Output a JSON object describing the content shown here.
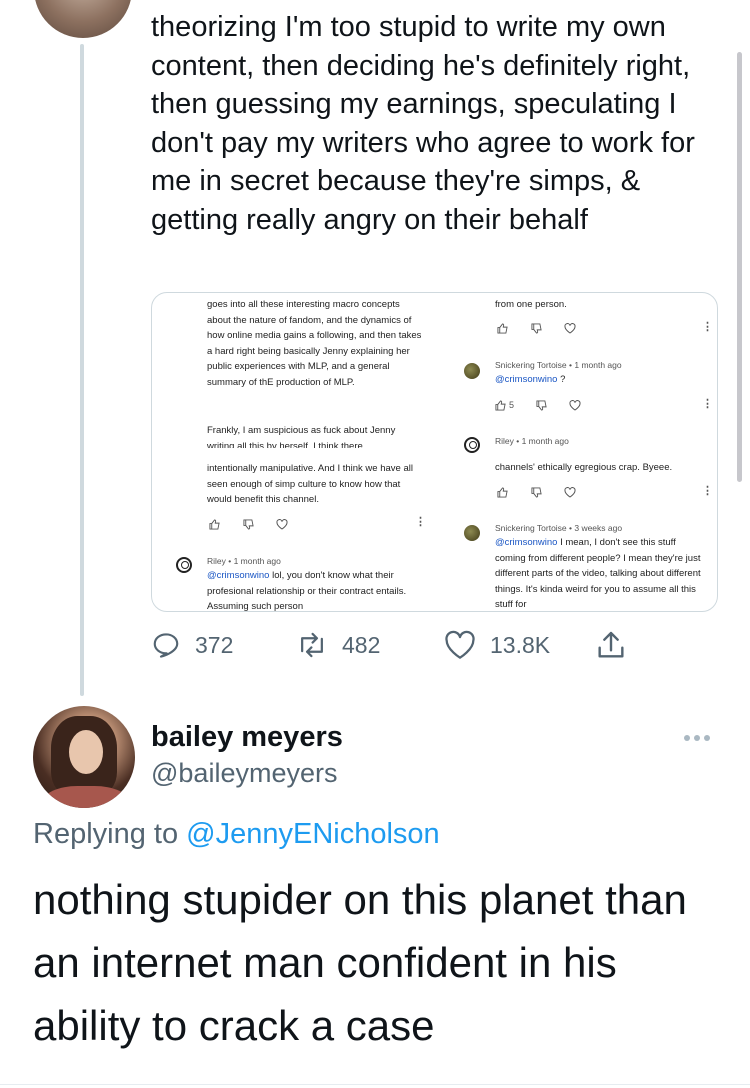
{
  "tweet1": {
    "text": "theorizing I'm too stupid to write my own content, then deciding he's definitely right, then guessing my earnings, speculating I don't pay my writers who agree to work for me in secret because they're simps, & getting really angry on their behalf",
    "replies": "372",
    "retweets": "482",
    "likes": "13.8K"
  },
  "media": {
    "left_top": "goes into all these interesting macro concepts about the nature of fandom, and the dynamics of how online media gains a following, and then takes a hard right being basically Jenny explaining her public experiences with MLP, and a general summary of thE production of MLP.",
    "left_frankly": "Frankly, I am suspicious as fuck about Jenny writing all this by herself. I think there",
    "left_manip": "intentionally manipulative. And I think we have all seen enough of simp culture to know how that would benefit this channel.",
    "riley_meta": "Riley • 1 month ago",
    "riley_handle": "@crimsonwino",
    "riley_text": " lol, you don't know what their profesional relationship or their contract entails. Assuming such person",
    "right_top": "from one person.",
    "tortoise1_meta": "Snickering Tortoise • 1 month ago",
    "tortoise1_handle": "@crimsonwino",
    "tortoise1_text": " ?",
    "tortoise1_likes": "5",
    "riley2_meta": "Riley • 1 month ago",
    "right_channels": "channels' ethically egregious crap. Byeee.",
    "tortoise2_meta": "Snickering Tortoise • 3 weeks ago",
    "tortoise2_handle": "@crimsonwino",
    "tortoise2_text": " I mean, I don't see this stuff coming from different people? I mean they're just different parts of the video, talking about different things. It's kinda weird for you to assume all this stuff for"
  },
  "tweet2": {
    "display_name": "bailey meyers",
    "handle": "@baileymeyers",
    "replying_prefix": "Replying to ",
    "replying_to": "@JennyENicholson",
    "text": "nothing stupider on this planet than an internet man confident in his ability to crack a case"
  },
  "colors": {
    "text": "#0f1419",
    "secondary": "#536471",
    "accent": "#1d9bf0",
    "divider": "#cfd9de"
  }
}
